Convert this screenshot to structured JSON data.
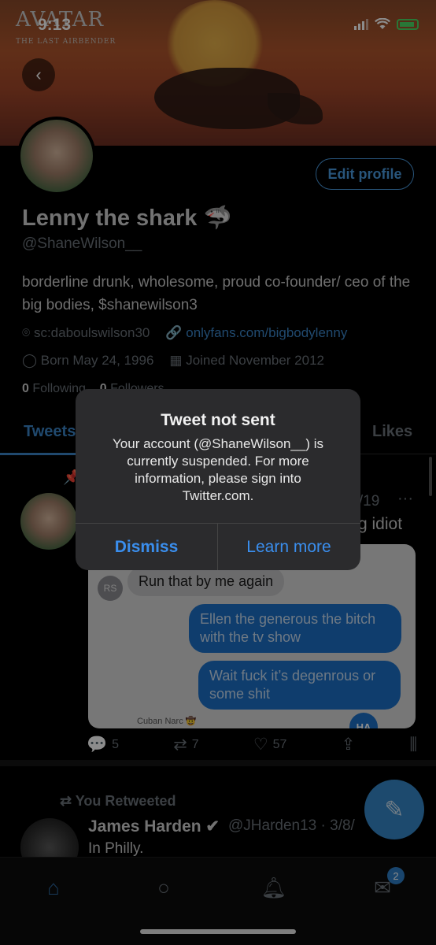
{
  "status_bar": {
    "time": "9:13"
  },
  "header": {
    "logo_text": "AVATAR",
    "logo_subtitle": "THE LAST AIRBENDER",
    "back_icon": "chevron-left-icon"
  },
  "profile": {
    "edit_label": "Edit profile",
    "name": "Lenny the shark 🦈",
    "handle": "@ShaneWilson__",
    "bio": "borderline drunk, wholesome, proud co-founder/ ceo of the big bodies, $shanewilson3",
    "location": "sc:daboulswilson30",
    "website": "onlyfans.com/bigbodylenny",
    "birthday": "Born May 24, 1996",
    "joined": "Joined November 2012",
    "following_count": "0",
    "following_label": "Following",
    "followers_count": "0",
    "followers_label": "Followers"
  },
  "tabs": {
    "tweets": "Tweets",
    "likes": "Likes"
  },
  "tweet": {
    "date": "/4/19",
    "more": "···",
    "text_fragment": "g idiot",
    "media": {
      "rs_initials": "RS",
      "msg_grey": "Run that by me again",
      "msg_blue_1": "Ellen the generous the bitch with the tv show",
      "msg_blue_2": "Wait fuck it’s degenrous or some shit",
      "sender_label": "Cuban Narc 🤠",
      "reaction": "HA"
    },
    "replies": "5",
    "retweets": "7",
    "likes": "57"
  },
  "tweet2": {
    "retweet_label": "You Retweeted",
    "name": "James Harden",
    "handle_date": "@JHarden13 · 3/8/",
    "text": "In Philly."
  },
  "tabbar": {
    "dm_badge": "2"
  },
  "alert": {
    "title": "Tweet not sent",
    "message": "Your account (@ShaneWilson__) is currently suspended. For more information, please sign into Twitter.com.",
    "dismiss": "Dismiss",
    "learn_more": "Learn more"
  }
}
